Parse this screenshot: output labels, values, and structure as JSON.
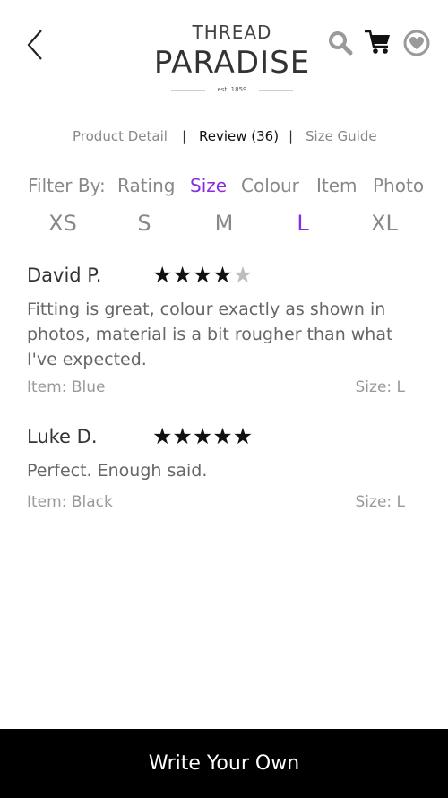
{
  "header": {
    "brand_top": "THREAD",
    "brand_main": "PARADISE",
    "brand_est": "est. 1859",
    "icons": [
      "back-icon",
      "search-icon",
      "cart-icon",
      "heart-icon"
    ]
  },
  "tabs": [
    {
      "label": "Product Detail",
      "active": false
    },
    {
      "label": "Review (36)",
      "active": true
    },
    {
      "label": "Size Guide",
      "active": false
    }
  ],
  "separator": "|",
  "filter": {
    "label": "Filter By:",
    "options": [
      "Rating",
      "Size",
      "Colour",
      "Item",
      "Photo"
    ],
    "active": "Size"
  },
  "sizes": {
    "options": [
      "XS",
      "S",
      "M",
      "L",
      "XL"
    ],
    "active": "L"
  },
  "reviews": [
    {
      "name": "David P.",
      "rating": 4,
      "max_rating": 5,
      "text": "Fitting is great, colour exactly as shown in photos, material is a bit rougher than what I've expected.",
      "item": "Item: Blue",
      "size": "Size: L"
    },
    {
      "name": "Luke D.",
      "rating": 5,
      "max_rating": 5,
      "text": "Perfect. Enough said.",
      "item": "Item: Black",
      "size": "Size: L"
    }
  ],
  "footer": {
    "write_label": "Write Your Own"
  },
  "colors": {
    "accent": "#8a2be2",
    "footer_bg": "#000000",
    "icon_gray": "#9a9a9a"
  }
}
